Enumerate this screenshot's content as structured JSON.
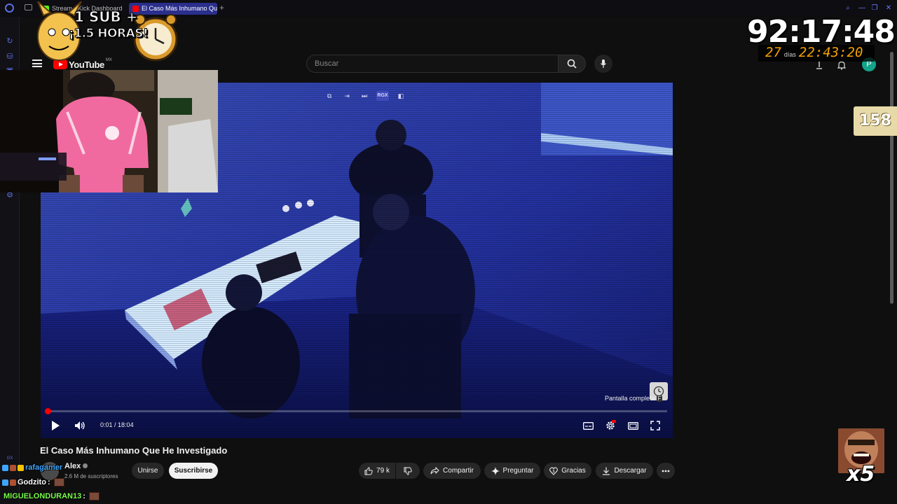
{
  "browser": {
    "tabs": [
      {
        "label": "Stream - Kick Dashboard"
      },
      {
        "label": "El Caso Más Inhumano Que"
      }
    ],
    "new_tab": "+"
  },
  "youtube": {
    "logo_text": "YouTube",
    "country": "MX",
    "search_placeholder": "Buscar",
    "avatar_letter": "P"
  },
  "player": {
    "top_controls": [
      "RGX"
    ],
    "tooltip": "Pantalla completa",
    "tooltip_key": "F",
    "current_time": "0:01",
    "duration": "18:04",
    "progress_fraction": 0.001
  },
  "video": {
    "title": "El Caso Más Inhumano Que He Investigado",
    "channel": "Alex",
    "subscribers": "2.6 M de suscriptores",
    "join_label": "Unirse",
    "subscribe_label": "Suscribirse",
    "likes": "79 k",
    "share_label": "Compartir",
    "ask_label": "Preguntar",
    "thanks_label": "Gracias",
    "download_label": "Descargar"
  },
  "overlay": {
    "banner_line1": "1 SUB +",
    "banner_line2": "¡1.5 HORAS!",
    "timer": "92:17:48",
    "countdown_days": "27",
    "countdown_days_label": "días",
    "countdown_time": "22:43:20",
    "counter": "158",
    "multiplier": "x5"
  },
  "chat": [
    {
      "user": "rafagamer",
      "color": "#3ea6ff"
    },
    {
      "user": "Godzito",
      "color": "#ffffff"
    },
    {
      "user": "MIGUELONDURAN13",
      "color": "#7bff4a"
    }
  ]
}
